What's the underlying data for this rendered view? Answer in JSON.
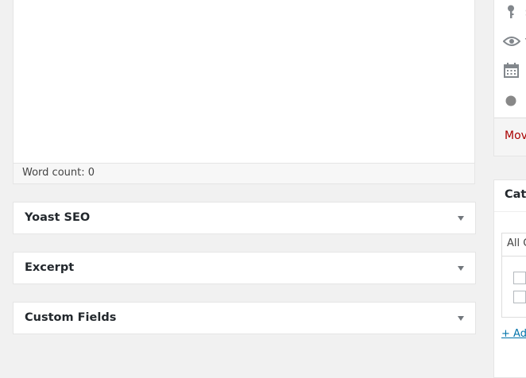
{
  "editor": {
    "word_count_label": "Word count: 0"
  },
  "metaboxes": [
    {
      "title": "Yoast SEO",
      "icon": "chevron-down-icon"
    },
    {
      "title": "Excerpt",
      "icon": "chevron-down-icon"
    },
    {
      "title": "Custom Fields",
      "icon": "chevron-down-icon"
    }
  ],
  "publish_box": {
    "rows": [
      {
        "icon": "key-icon",
        "text": "S"
      },
      {
        "icon": "eye-icon",
        "text": "V"
      },
      {
        "icon": "calendar-icon",
        "text": ""
      },
      {
        "icon": "circle-icon",
        "text": ""
      }
    ],
    "move_to_trash": "Mov"
  },
  "categories_box": {
    "title": "Cate",
    "tab_label": "All C",
    "add_new": "+ Ad"
  },
  "colors": {
    "background": "#f1f1f1",
    "trash_link": "#a00",
    "link": "#0073aa"
  }
}
